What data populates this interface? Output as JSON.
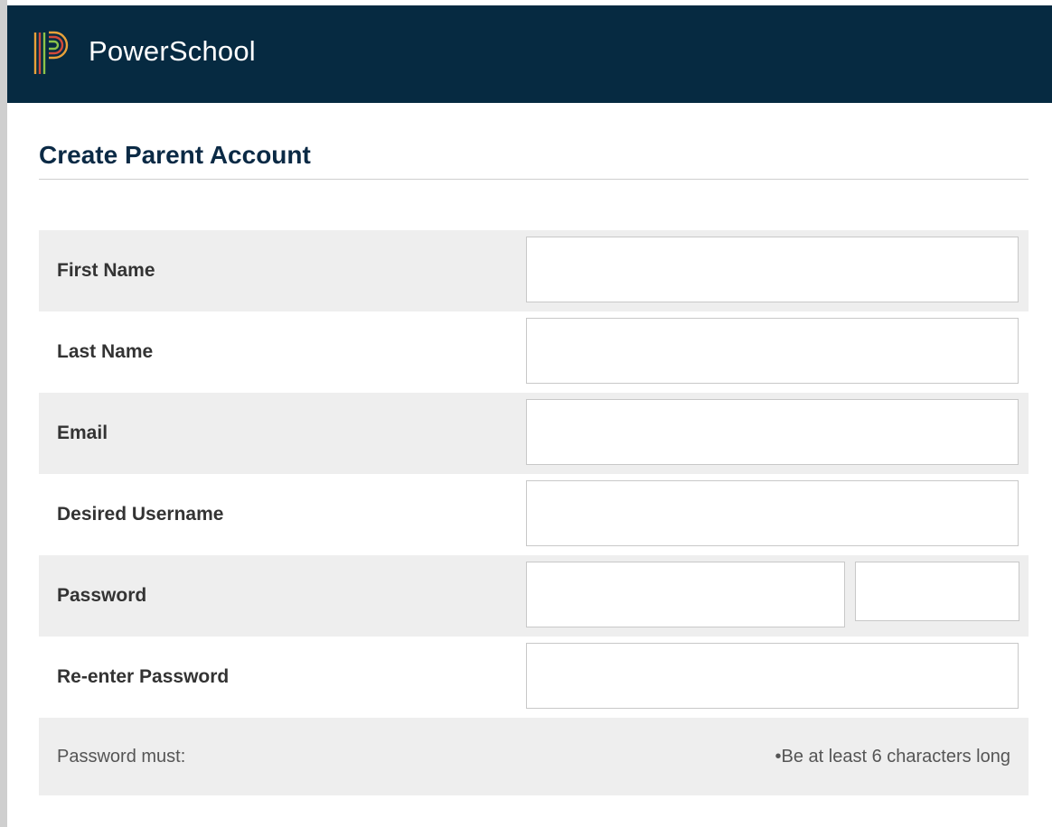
{
  "header": {
    "brand_name": "PowerSchool",
    "background_color": "#062a41",
    "logo_icon": "powerschool-p-logo-icon"
  },
  "page": {
    "title": "Create Parent Account",
    "title_color": "#0b2a45"
  },
  "form": {
    "fields": [
      {
        "label": "First Name",
        "value": ""
      },
      {
        "label": "Last Name",
        "value": ""
      },
      {
        "label": "Email",
        "value": ""
      },
      {
        "label": "Desired Username",
        "value": ""
      },
      {
        "label": "Password",
        "value": ""
      },
      {
        "label": "Re-enter Password",
        "value": ""
      }
    ],
    "row_shade_color": "#eeeeee"
  },
  "password_rules": {
    "label": "Password must:",
    "items": [
      "•Be at least 6 characters long"
    ]
  }
}
